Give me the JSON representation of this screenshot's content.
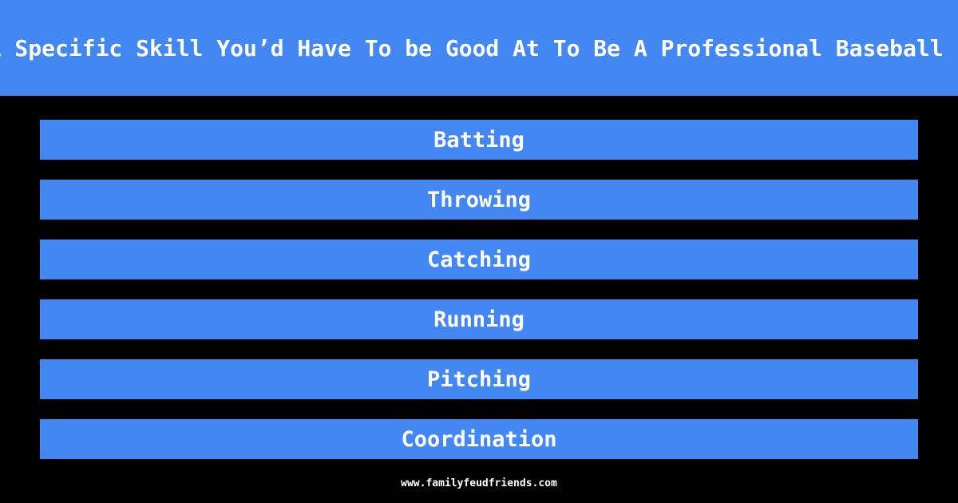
{
  "header": {
    "title": "Name A Specific Skill You’d Have To be Good At To Be A Professional Baseball Player"
  },
  "answers": [
    {
      "label": "Batting"
    },
    {
      "label": "Throwing"
    },
    {
      "label": "Catching"
    },
    {
      "label": "Running"
    },
    {
      "label": "Pitching"
    },
    {
      "label": "Coordination"
    }
  ],
  "footer": {
    "url": "www.familyfeudfriends.com"
  },
  "colors": {
    "accent": "#4387f3",
    "background": "#000000",
    "text": "#ffffff"
  }
}
